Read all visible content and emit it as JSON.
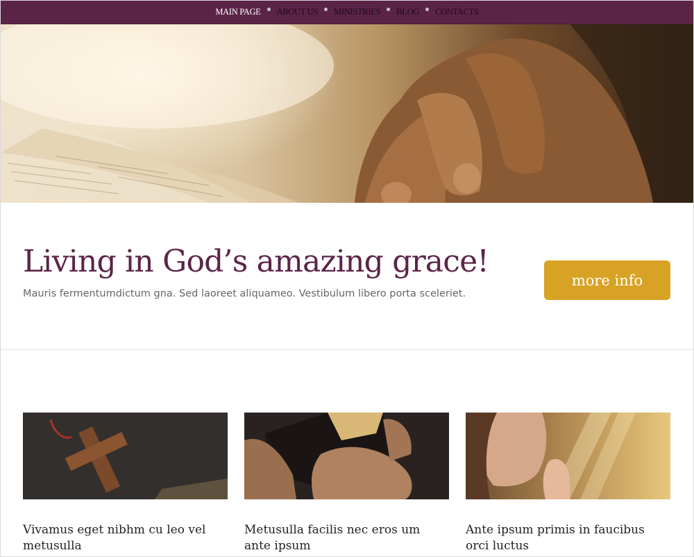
{
  "nav": {
    "items": [
      {
        "label": "MAIN PAGE",
        "active": true
      },
      {
        "label": "ABOUT US",
        "active": false
      },
      {
        "label": "MINISTRIES",
        "active": false
      },
      {
        "label": "BLOG",
        "active": false
      },
      {
        "label": "CONTACTS",
        "active": false
      }
    ]
  },
  "intro": {
    "title": "Living in God’s amazing grace!",
    "subtitle": "Mauris fermentumdictum gna. Sed laoreet aliquameo. Vestibulum libero porta sceleriet.",
    "button_label": "more info"
  },
  "cards": [
    {
      "title": "Vivamus eget nibhm cu leo vel metusulla"
    },
    {
      "title": "Metusulla facilis nec eros um ante ipsum"
    },
    {
      "title": "Ante ipsum primis in faucibus orci luctus"
    }
  ],
  "colors": {
    "nav_bg": "#5b2447",
    "title": "#5b2447",
    "button": "#d8a325",
    "body_text": "#666666"
  }
}
